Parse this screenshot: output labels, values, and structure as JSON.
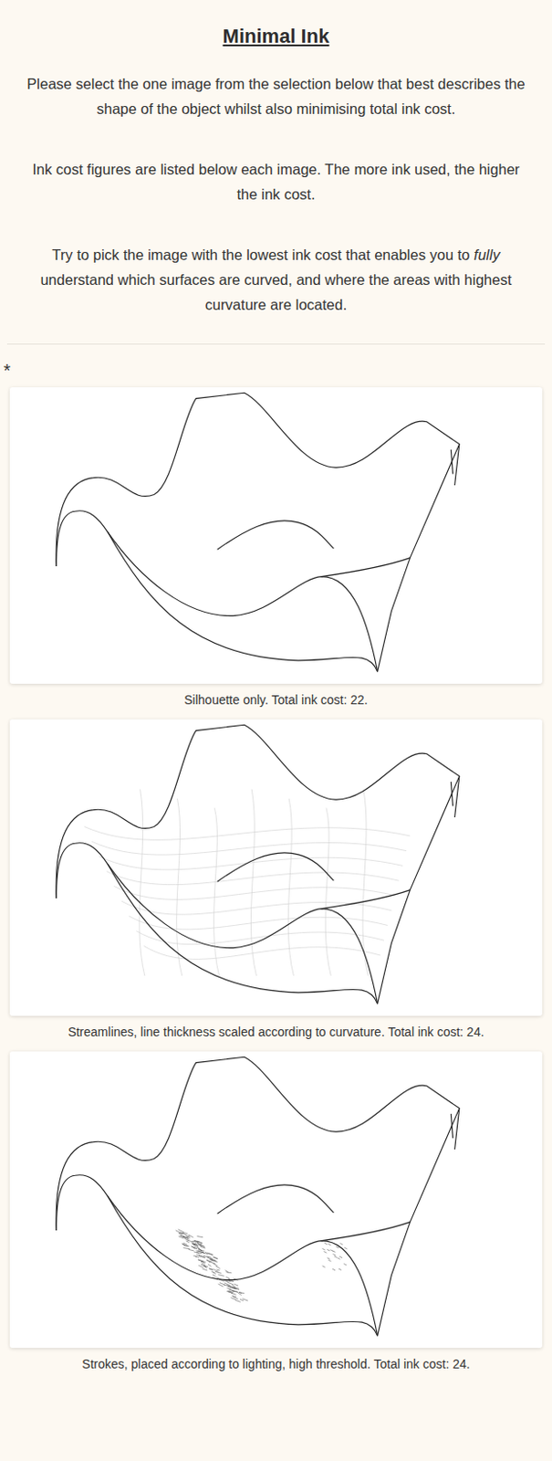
{
  "title": "Minimal Ink",
  "paragraphs": [
    [
      {
        "text": "Please select the one image from the selection below that best describes the shape of the object whilst also minimising total ink cost.",
        "italic": false
      }
    ],
    [
      {
        "text": "Ink cost figures are listed below each image. The more ink used, the higher the ink cost.",
        "italic": false
      }
    ],
    [
      {
        "text": "Try to pick the image with the lowest ink cost that enables you to ",
        "italic": false
      },
      {
        "text": "fully",
        "italic": true
      },
      {
        "text": " understand which surfaces are curved, and where the areas with highest curvature are located.",
        "italic": false
      }
    ]
  ],
  "required_mark": "*",
  "options": [
    {
      "caption": "Silhouette only. Total ink cost: 22.",
      "kind": "silhouette",
      "selected": false
    },
    {
      "caption": "Streamlines, line thickness scaled according to curvature. Total ink cost: 24.",
      "kind": "streamlines",
      "selected": false
    },
    {
      "caption": "Strokes, placed according to lighting, high threshold. Total ink cost: 24.",
      "kind": "strokes",
      "selected": false
    }
  ]
}
